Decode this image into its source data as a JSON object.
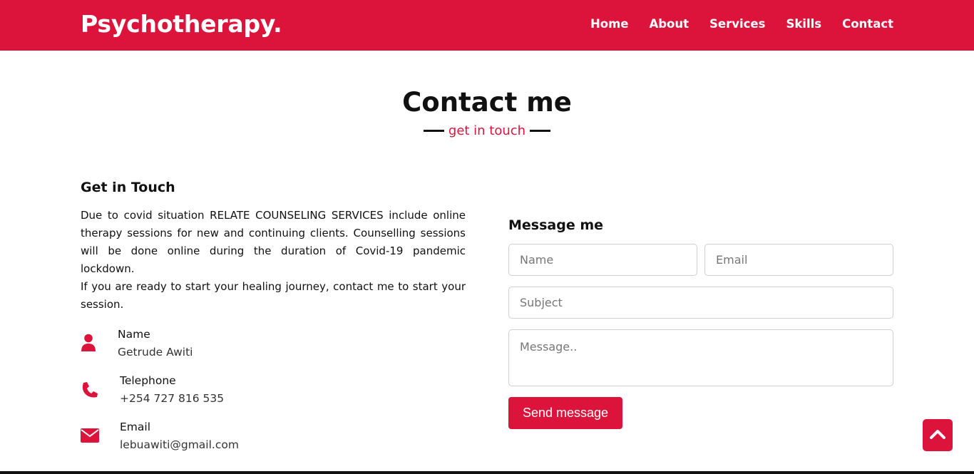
{
  "navbar": {
    "brand": "Psychotherapy.",
    "links": [
      "Home",
      "About",
      "Services",
      "Skills",
      "Contact"
    ]
  },
  "section": {
    "title": "Contact me",
    "subtitle": "get in touch"
  },
  "left": {
    "heading": "Get in Touch",
    "paragraph_1": "Due to covid situation RELATE COUNSELING SERVICES include online therapy sessions for new and continuing clients. Counselling sessions will be done online during the duration of Covid-19 pandemic lockdown.",
    "paragraph_2": "If you are ready to start your healing journey, contact me to start your session.",
    "info": [
      {
        "icon": "user-icon",
        "label": "Name",
        "value": "Getrude Awiti"
      },
      {
        "icon": "phone-icon",
        "label": "Telephone",
        "value": "+254 727 816 535"
      },
      {
        "icon": "envelope-icon",
        "label": "Email",
        "value": "lebuawiti@gmail.com"
      }
    ]
  },
  "form": {
    "heading": "Message me",
    "name_placeholder": "Name",
    "email_placeholder": "Email",
    "subject_placeholder": "Subject",
    "message_placeholder": "Message..",
    "send_label": "Send message"
  },
  "colors": {
    "accent": "#dc143c"
  },
  "scroll_top_icon": "chevron-up-icon"
}
